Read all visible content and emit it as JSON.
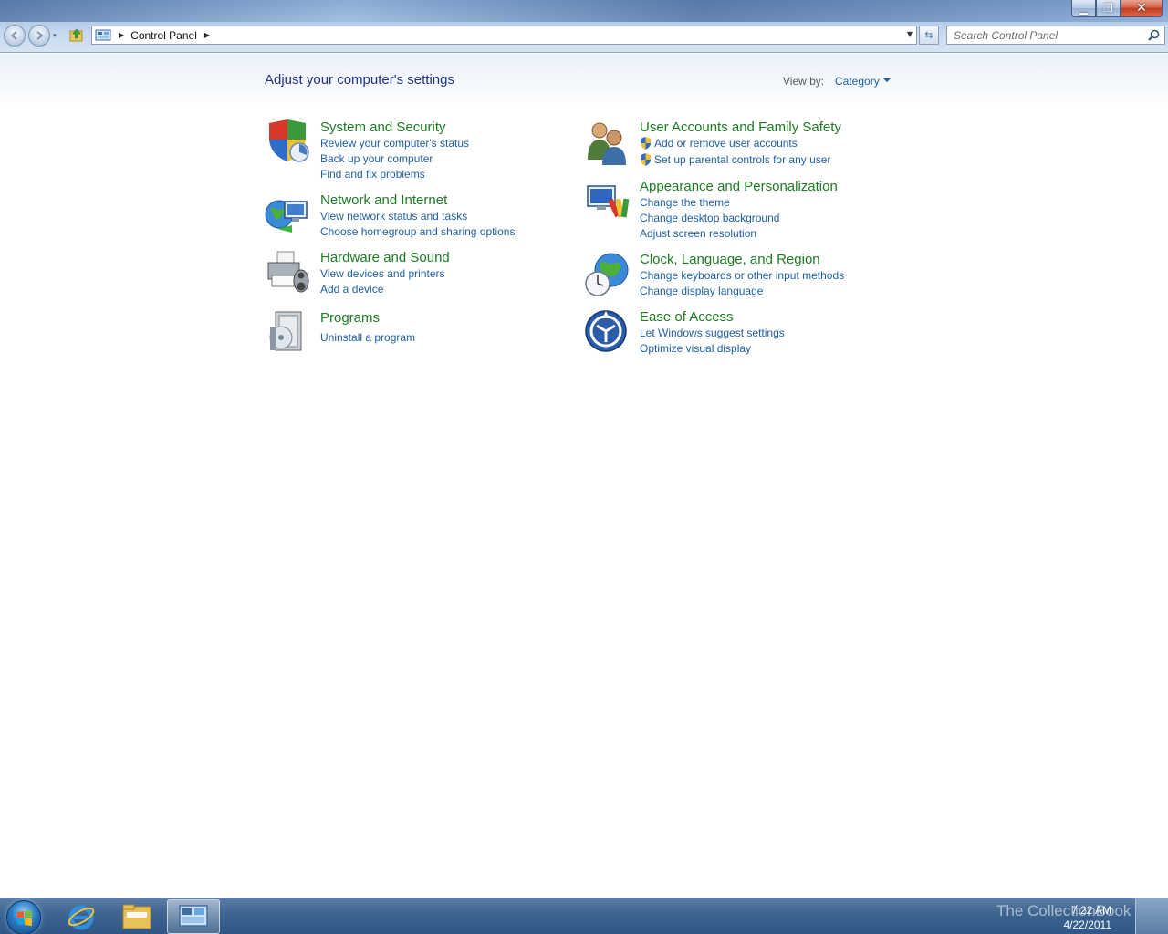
{
  "window": {
    "caption_buttons": {
      "minimize": "▁",
      "maximize": "❐",
      "close": "✕"
    }
  },
  "nav": {
    "back_icon": "back-arrow-icon",
    "forward_icon": "forward-arrow-icon",
    "history_arrow": "▾"
  },
  "address": {
    "sep1": "▶",
    "crumb": "Control Panel",
    "sep2": "▶",
    "dropdown": "▼"
  },
  "refresh": {
    "icon": "⇆"
  },
  "search": {
    "placeholder": "Search Control Panel"
  },
  "content": {
    "title": "Adjust your computer's settings",
    "view_by_label": "View by:",
    "view_by_value": "Category"
  },
  "categories_left": [
    {
      "title": "System and Security",
      "icon": "shield-icon",
      "links": [
        "Review your computer's status",
        "Back up your computer",
        "Find and fix problems"
      ]
    },
    {
      "title": "Network and Internet",
      "icon": "network-icon",
      "links": [
        "View network status and tasks",
        "Choose homegroup and sharing options"
      ]
    },
    {
      "title": "Hardware and Sound",
      "icon": "printer-icon",
      "links": [
        "View devices and printers",
        "Add a device"
      ]
    },
    {
      "title": "Programs",
      "icon": "programs-icon",
      "links": [
        "Uninstall a program"
      ]
    }
  ],
  "categories_right": [
    {
      "title": "User Accounts and Family Safety",
      "icon": "users-icon",
      "links": [
        "Add or remove user accounts",
        "Set up parental controls for any user"
      ]
    },
    {
      "title": "Appearance and Personalization",
      "icon": "appearance-icon",
      "links": [
        "Change the theme",
        "Change desktop background",
        "Adjust screen resolution"
      ]
    },
    {
      "title": "Clock, Language, and Region",
      "icon": "clock-globe-icon",
      "links": [
        "Change keyboards or other input methods",
        "Change display language"
      ]
    },
    {
      "title": "Ease of Access",
      "icon": "ease-of-access-icon",
      "links": [
        "Let Windows suggest settings",
        "Optimize visual display"
      ]
    }
  ],
  "taskbar": {
    "time": "7:22 AM",
    "date": "4/22/2011",
    "watermark": "The CollectionBook"
  },
  "colors": {
    "category_title": "#1d7b22",
    "link": "#1e5fa6",
    "page_title": "#1e3287"
  }
}
